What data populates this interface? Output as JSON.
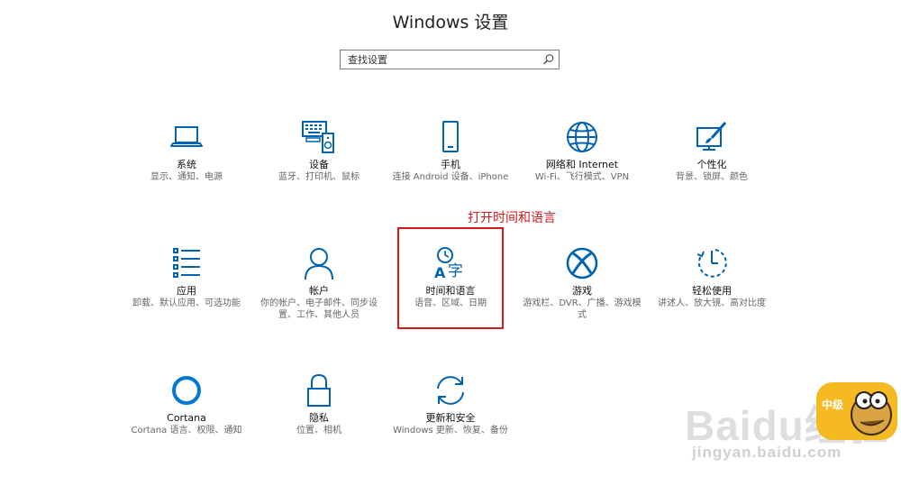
{
  "window": {
    "title": "Windows 设置"
  },
  "search": {
    "placeholder": "查找设置"
  },
  "tiles": [
    {
      "name": "系统",
      "desc": "显示、通知、电源",
      "icon": "laptop-icon"
    },
    {
      "name": "设备",
      "desc": "蓝牙、打印机、鼠标",
      "icon": "keyboard-speaker-icon"
    },
    {
      "name": "手机",
      "desc": "连接 Android 设备、iPhone",
      "icon": "phone-icon"
    },
    {
      "name": "网络和 Internet",
      "desc": "Wi-Fi、飞行模式、VPN",
      "icon": "globe-icon"
    },
    {
      "name": "个性化",
      "desc": "背景、锁屏、颜色",
      "icon": "paint-monitor-icon"
    },
    {
      "name": "应用",
      "desc": "卸载、默认应用、可选功能",
      "icon": "app-list-icon"
    },
    {
      "name": "帐户",
      "desc": "你的帐户、电子邮件、同步设置、工作、其他人员",
      "icon": "person-icon"
    },
    {
      "name": "时间和语言",
      "desc": "语音、区域、日期",
      "icon": "time-language-icon"
    },
    {
      "name": "游戏",
      "desc": "游戏栏、DVR、广播、游戏模式",
      "icon": "xbox-icon"
    },
    {
      "name": "轻松使用",
      "desc": "讲述人、放大镜、高对比度",
      "icon": "ease-of-access-icon"
    },
    {
      "name": "Cortana",
      "desc": "Cortana 语言、权限、通知",
      "icon": "cortana-icon"
    },
    {
      "name": "隐私",
      "desc": "位置、相机",
      "icon": "lock-icon"
    },
    {
      "name": "更新和安全",
      "desc": "Windows 更新、恢复、备份",
      "icon": "sync-icon"
    }
  ],
  "annotation": {
    "text": "打开时间和语言"
  },
  "watermark": {
    "logo": "Baidu经验",
    "url": "jingyan.baidu.com",
    "badge": "中级"
  },
  "colors": {
    "accent": "#0063b1",
    "annotation": "#d21a1a"
  }
}
